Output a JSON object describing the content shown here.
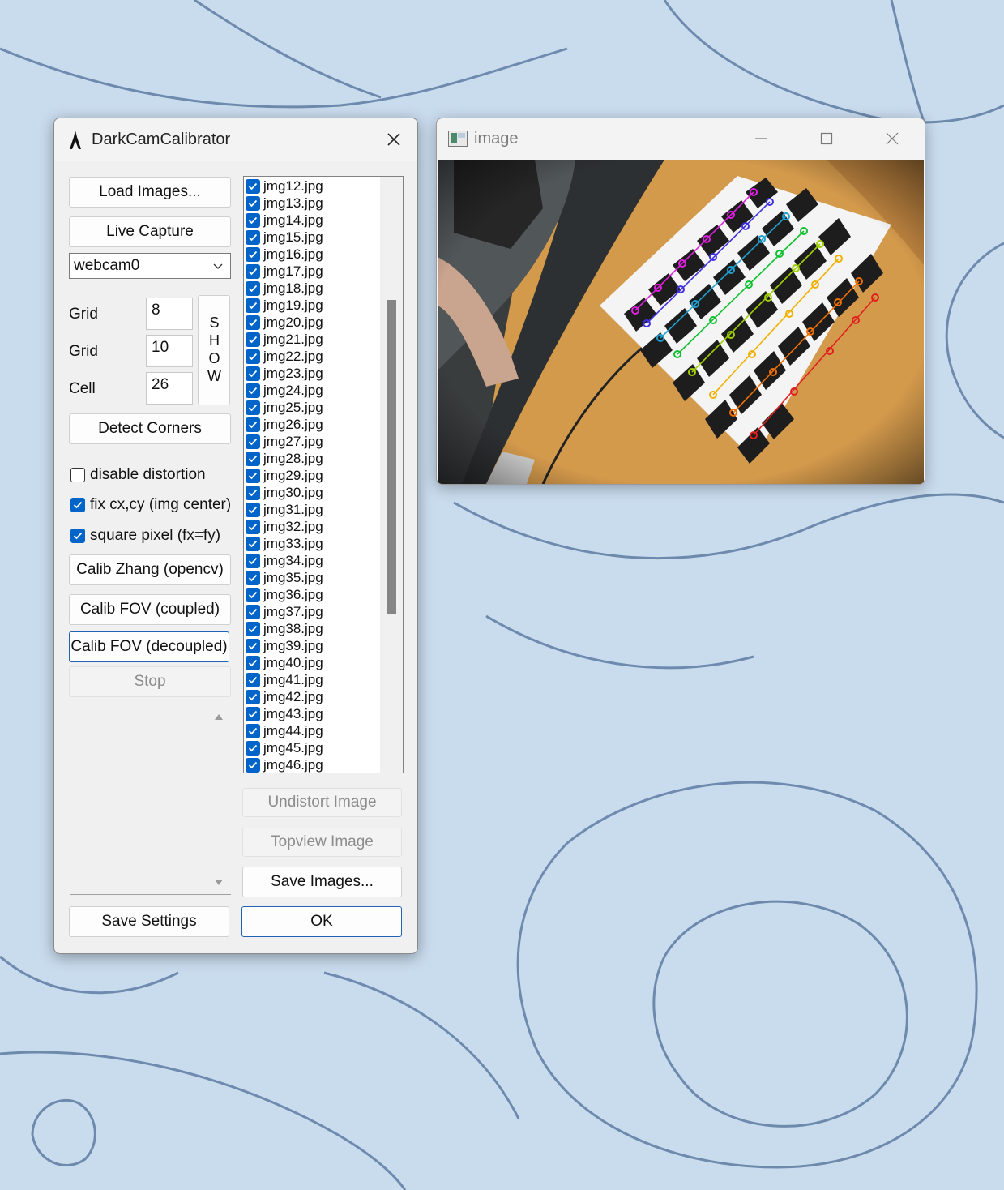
{
  "dialog": {
    "title": "DarkCamCalibrator",
    "load_images": "Load Images...",
    "live_capture": "Live Capture",
    "camera_select": "webcam0",
    "grid_label_1": "Grid",
    "grid_value_1": "8",
    "grid_label_2": "Grid",
    "grid_value_2": "10",
    "cell_label": "Cell",
    "cell_value": "26",
    "show_button": "SHOW",
    "detect_corners": "Detect Corners",
    "options": [
      {
        "label": "disable distortion",
        "checked": false
      },
      {
        "label": "fix cx,cy (img center)",
        "checked": true
      },
      {
        "label": "square pixel (fx=fy)",
        "checked": true
      }
    ],
    "calib_zhang": "Calib Zhang (opencv)",
    "calib_fov_coupled": "Calib FOV (coupled)",
    "calib_fov_decoupled": "Calib FOV (decoupled)",
    "stop": "Stop",
    "files": [
      "jmg12.jpg",
      "jmg13.jpg",
      "jmg14.jpg",
      "jmg15.jpg",
      "jmg16.jpg",
      "jmg17.jpg",
      "jmg18.jpg",
      "jmg19.jpg",
      "jmg20.jpg",
      "jmg21.jpg",
      "jmg22.jpg",
      "jmg23.jpg",
      "jmg24.jpg",
      "jmg25.jpg",
      "jmg26.jpg",
      "jmg27.jpg",
      "jmg28.jpg",
      "jmg29.jpg",
      "jmg30.jpg",
      "jmg31.jpg",
      "jmg32.jpg",
      "jmg33.jpg",
      "jmg34.jpg",
      "jmg35.jpg",
      "jmg36.jpg",
      "jmg37.jpg",
      "jmg38.jpg",
      "jmg39.jpg",
      "jmg40.jpg",
      "jmg41.jpg",
      "jmg42.jpg",
      "jmg43.jpg",
      "jmg44.jpg",
      "jmg45.jpg",
      "jmg46.jpg"
    ],
    "undistort_image": "Undistort Image",
    "topview_image": "Topview Image",
    "save_images": "Save Images...",
    "save_settings": "Save Settings",
    "ok": "OK"
  },
  "image_window": {
    "title": "image"
  },
  "colors": {
    "accent": "#0064c8",
    "wallpaper": "#c7daec"
  }
}
